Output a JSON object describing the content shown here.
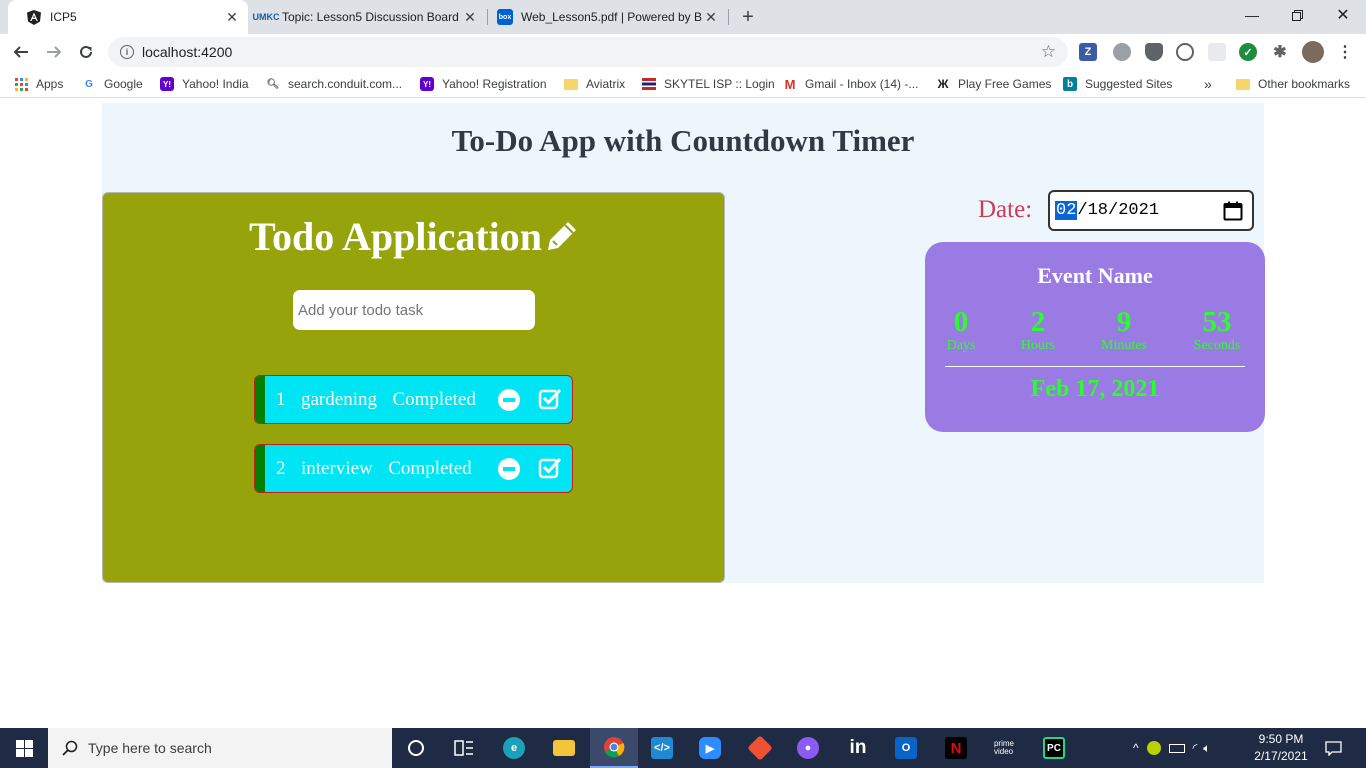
{
  "browser": {
    "tabs": [
      {
        "title": "ICP5",
        "favicon": "angular-icon",
        "active": true
      },
      {
        "title": "Topic: Lesson5 Discussion Board",
        "favicon": "umkc-icon",
        "active": false
      },
      {
        "title": "Web_Lesson5.pdf | Powered by B",
        "favicon": "box-icon",
        "active": false
      }
    ],
    "new_tab": "+",
    "url": "localhost:4200",
    "bookmarks": [
      {
        "label": "Apps",
        "icon": "apps-grid-icon"
      },
      {
        "label": "Google",
        "icon": "google-icon"
      },
      {
        "label": "Yahoo! India",
        "icon": "yahoo-icon"
      },
      {
        "label": "search.conduit.com...",
        "icon": "search-icon"
      },
      {
        "label": "Yahoo! Registration",
        "icon": "yahoo-icon"
      },
      {
        "label": "Aviatrix",
        "icon": "folder-icon"
      },
      {
        "label": "SKYTEL ISP :: Login",
        "icon": "skytel-icon"
      },
      {
        "label": "Gmail - Inbox (14) -...",
        "icon": "gmail-icon"
      },
      {
        "label": "Play Free Games",
        "icon": "games-icon"
      },
      {
        "label": "Suggested Sites",
        "icon": "bing-icon"
      }
    ],
    "bookmarks_overflow": "»",
    "other_bookmarks": "Other bookmarks"
  },
  "app": {
    "heading": "To-Do App with Countdown Timer",
    "todo": {
      "title": "Todo Application",
      "input_placeholder": "Add your todo task",
      "items": [
        {
          "text": "1  gardening  Completed"
        },
        {
          "text": "2  interview  Completed"
        }
      ]
    },
    "date": {
      "label": "Date:",
      "month": "02",
      "day": "18",
      "year": "2021",
      "separator": "/"
    },
    "countdown": {
      "event_name": "Event Name",
      "units": [
        {
          "value": "0",
          "label": "Days"
        },
        {
          "value": "2",
          "label": "Hours"
        },
        {
          "value": "9",
          "label": "Minutes"
        },
        {
          "value": "53",
          "label": "Seconds"
        }
      ],
      "target_date": "Feb 17, 2021"
    }
  },
  "taskbar": {
    "search_placeholder": "Type here to search",
    "time": "9:50 PM",
    "date": "2/17/2021"
  },
  "colors": {
    "todo_panel": "#97a30b",
    "todo_item": "#00e5f4",
    "countdown_panel": "#9a7be3",
    "countdown_text": "#2bff2b",
    "date_label": "#d13b52"
  }
}
